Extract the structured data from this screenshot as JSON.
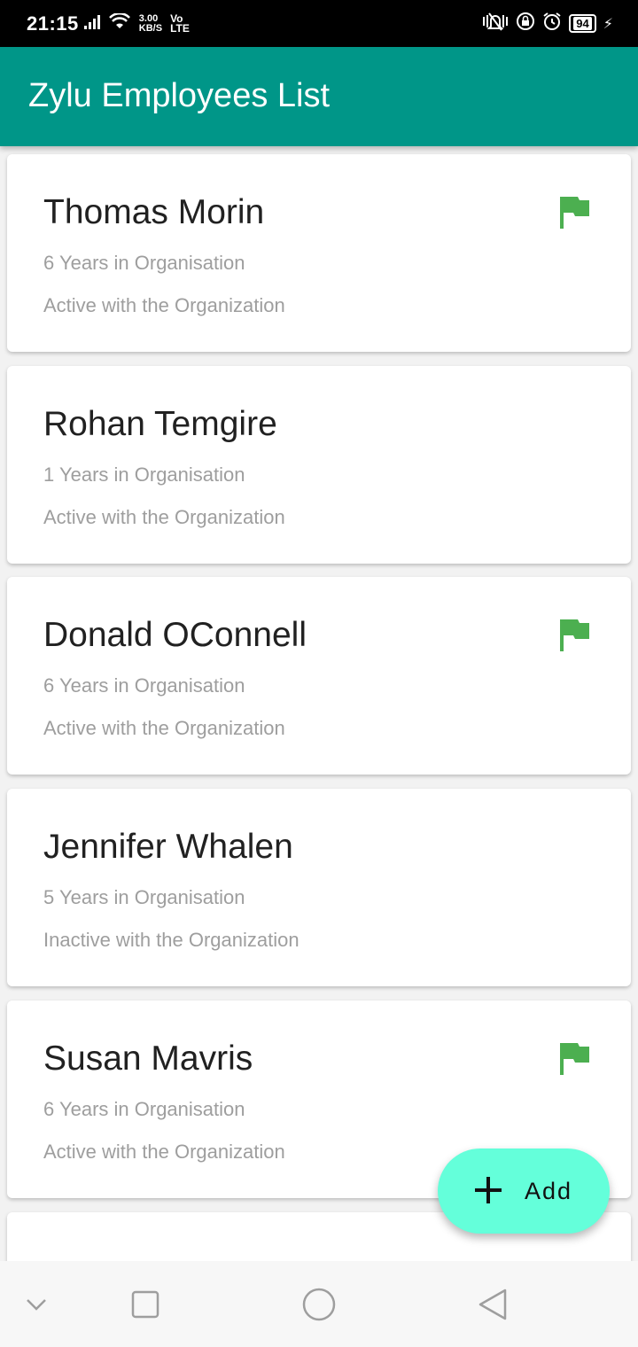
{
  "status_bar": {
    "time": "21:15",
    "speed_value": "3.00",
    "speed_unit": "KB/S",
    "volte_top": "Vo",
    "volte_bottom": "LTE",
    "battery": "94",
    "icons": [
      "signal-icon",
      "wifi-icon",
      "vibrate-icon",
      "screen-lock-icon",
      "alarm-icon",
      "battery-icon",
      "charging-icon"
    ]
  },
  "app_bar": {
    "title": "Zylu Employees List",
    "color": "#009688"
  },
  "employees": [
    {
      "name": "Thomas Morin",
      "years": "6 Years in Organisation",
      "status": "Active with the Organization",
      "flagged": true
    },
    {
      "name": "Rohan Temgire",
      "years": "1 Years in Organisation",
      "status": "Active with the Organization",
      "flagged": false
    },
    {
      "name": "Donald OConnell",
      "years": "6 Years in Organisation",
      "status": "Active with the Organization",
      "flagged": true
    },
    {
      "name": "Jennifer Whalen",
      "years": "5 Years in Organisation",
      "status": "Inactive with the Organization",
      "flagged": false
    },
    {
      "name": "Susan Mavris",
      "years": "6 Years in Organisation",
      "status": "Active with the Organization",
      "flagged": true
    }
  ],
  "flag_color": "#4caf50",
  "fab": {
    "label": "Add",
    "icon": "plus-icon",
    "color": "#64ffda"
  },
  "nav_bar": {
    "icons": [
      "chevron-down-icon",
      "recents-icon",
      "home-icon",
      "back-icon"
    ]
  }
}
